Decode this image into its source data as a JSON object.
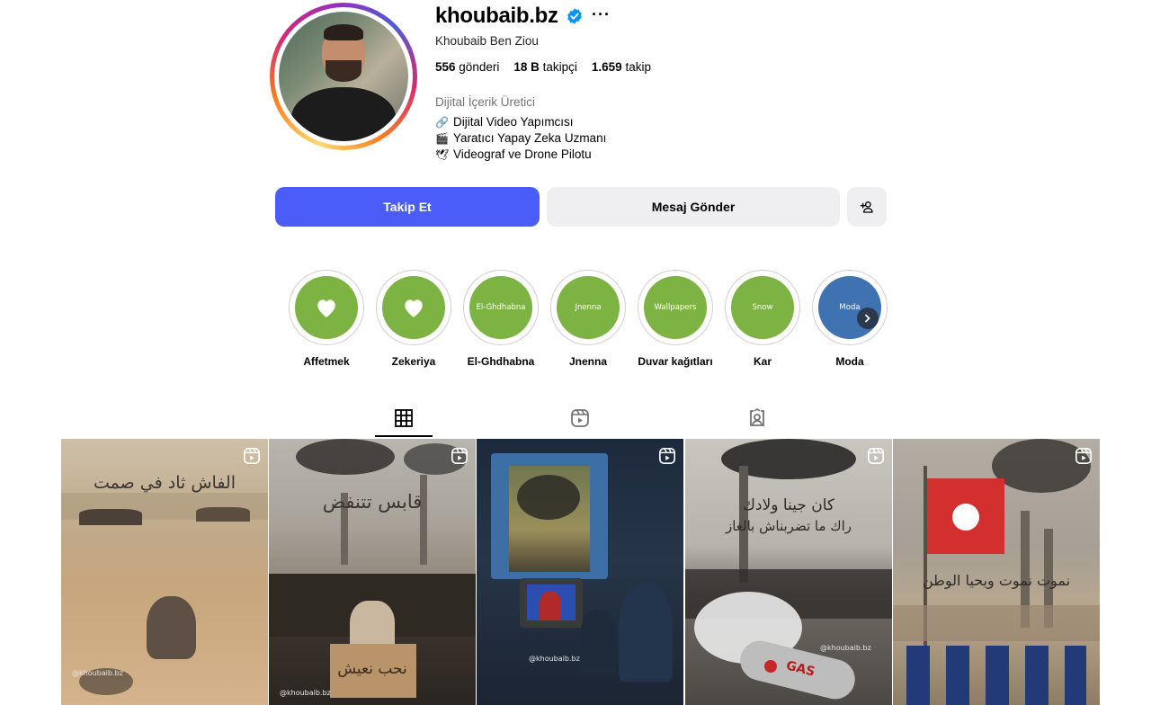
{
  "profile": {
    "username": "khoubaib.bz",
    "full_name": "Khoubaib Ben Ziou",
    "category": "Dijital İçerik Üretici",
    "stats": [
      {
        "count": "556",
        "label": "gönderi"
      },
      {
        "count": "18 B",
        "label": "takipçi"
      },
      {
        "count": "1.659",
        "label": "takip"
      }
    ],
    "bio": [
      {
        "icon": "🔗",
        "text": "Dijital Video Yapımcısı"
      },
      {
        "icon": "🎬",
        "text": "Yaratıcı Yapay Zeka Uzmanı"
      },
      {
        "icon": "🕊",
        "text": "Videograf ve Drone Pilotu"
      }
    ],
    "verified_icon": "verified-badge-icon",
    "more_icon": "···"
  },
  "actions": {
    "follow_label": "Takip Et",
    "message_label": "Mesaj Gönder",
    "add_user_icon": "add-user-icon"
  },
  "highlights": [
    {
      "label": "Affetmek",
      "cover": "heart",
      "cover_text": ""
    },
    {
      "label": "Zekeriya",
      "cover": "heart",
      "cover_text": ""
    },
    {
      "label": "El-Ghdhabna",
      "cover": "text",
      "cover_text": "El-Ghdhabna"
    },
    {
      "label": "Jnenna",
      "cover": "text",
      "cover_text": "Jnenna"
    },
    {
      "label": "Duvar kağıtları",
      "cover": "text",
      "cover_text": "Wallpapers"
    },
    {
      "label": "Kar",
      "cover": "text",
      "cover_text": "Snow"
    },
    {
      "label": "Moda",
      "cover": "text",
      "cover_text": "Moda"
    }
  ],
  "tabs": [
    {
      "name": "posts",
      "icon": "grid-icon",
      "active": true
    },
    {
      "name": "reels",
      "icon": "reels-icon",
      "active": false
    },
    {
      "name": "tagged",
      "icon": "tagged-icon",
      "active": false
    }
  ],
  "posts": [
    {
      "caption": "الفاش ثاد في صمت",
      "watermark": "@khoubaib.bz"
    },
    {
      "caption": "قابس تتنفض",
      "sign": "نحب نعيش",
      "watermark": "@khoubaib.bz"
    },
    {
      "caption": "",
      "watermark": "@khoubaib.bz"
    },
    {
      "caption": "كان جينا ولادك",
      "caption2": "راك ما تضربناش بالغاز",
      "label": "GAS",
      "watermark": "@khoubaib.bz"
    },
    {
      "caption": "نموت نموت ويحيا الوطن",
      "watermark": ""
    }
  ],
  "colors": {
    "follow_button": "#4a5df9",
    "secondary_button": "#efeff1",
    "highlight_green": "#7cb342",
    "highlight_blue": "#3f72b0",
    "verified_blue": "#0095f6"
  }
}
